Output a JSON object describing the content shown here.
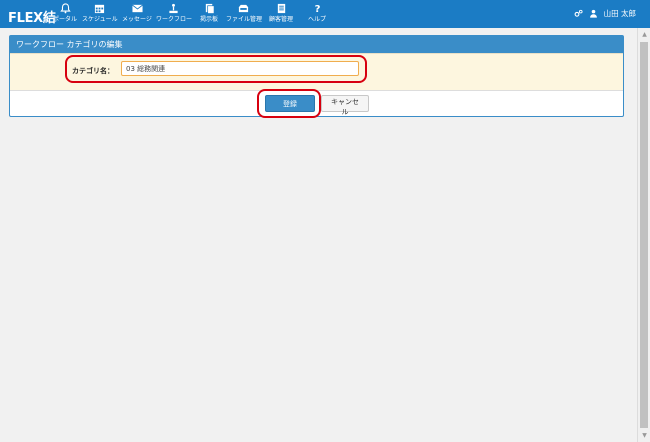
{
  "app": {
    "brand": "FLEX結"
  },
  "nav": [
    {
      "label": "ポータル",
      "icon": "bell-icon"
    },
    {
      "label": "スケジュール",
      "icon": "calendar-icon"
    },
    {
      "label": "メッセージ",
      "icon": "envelope-icon"
    },
    {
      "label": "ワークフロー",
      "icon": "workflow-icon"
    },
    {
      "label": "掲示板",
      "icon": "board-icon"
    },
    {
      "label": "ファイル管理",
      "icon": "folder-icon"
    },
    {
      "label": "顧客管理",
      "icon": "customer-icon"
    },
    {
      "label": "ヘルプ",
      "icon": "help-icon"
    }
  ],
  "user": {
    "name": "山田 太郎"
  },
  "panel": {
    "title": "ワークフロー カテゴリの編集",
    "field_label": "カテゴリ名：",
    "field_value": "03 総務関連"
  },
  "buttons": {
    "save": "登録",
    "cancel": "キャンセル"
  },
  "colors": {
    "navbar": "#1b7cc5",
    "panel_header": "#3a8dc8",
    "form_row": "#fdf6df",
    "highlight": "#d7000f"
  }
}
